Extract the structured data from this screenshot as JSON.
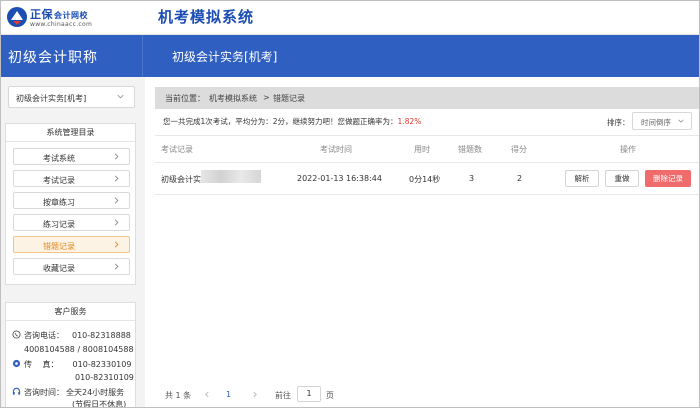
{
  "brand": {
    "name": "正保",
    "sub": "会计网校",
    "url": "www.chinaacc.com",
    "system_title": "机考模拟系统"
  },
  "header": {
    "left_title": "初级会计职称",
    "course_title": "初级会计实务[机考]"
  },
  "sidebar": {
    "course_select": "初级会计实务[机考]",
    "menu_title": "系统管理目录",
    "items": [
      {
        "label": "考试系统",
        "active": false
      },
      {
        "label": "考试记录",
        "active": false
      },
      {
        "label": "按章练习",
        "active": false
      },
      {
        "label": "练习记录",
        "active": false
      },
      {
        "label": "错题记录",
        "active": true
      },
      {
        "label": "收藏记录",
        "active": false
      }
    ],
    "service": {
      "title": "客户服务",
      "phone_label": "咨询电话：",
      "phone1": "010-82318888",
      "phone2": "4008104588 / 8008104588",
      "fax_label": "传　 真：",
      "fax1": "010-82330109",
      "fax2": "010-82310109",
      "hours_label": "咨询时间：",
      "hours": "全天24小时服务",
      "holiday": "(节假日不休息)"
    }
  },
  "breadcrumb": {
    "prefix": "当前位置：",
    "level1": "机考模拟系统",
    "sep": ">",
    "level2": "错题记录"
  },
  "summary": {
    "text": "您一共完成1次考试，平均分为：2分，继续努力吧！您做题正确率为：",
    "rate": "1.82%"
  },
  "sort": {
    "label": "排序：",
    "value": "时间倒序"
  },
  "table": {
    "columns": [
      "考试记录",
      "考试时间",
      "用时",
      "错题数",
      "得分",
      "操作"
    ],
    "rows": [
      {
        "record": "初级会计实",
        "time": "2022-01-13 16:38:44",
        "duration": "0分14秒",
        "wrong": "3",
        "score": "2",
        "actions": [
          "解析",
          "重做",
          "删除记录"
        ]
      }
    ]
  },
  "pager": {
    "total": "共 1 条",
    "current": "1",
    "goto_label": "前往",
    "goto_value": "1",
    "page_unit": "页"
  },
  "colors": {
    "primary": "#2f5fc0",
    "active_text": "#e08a1e",
    "danger": "#f06b6b",
    "rate": "#e4392f"
  }
}
